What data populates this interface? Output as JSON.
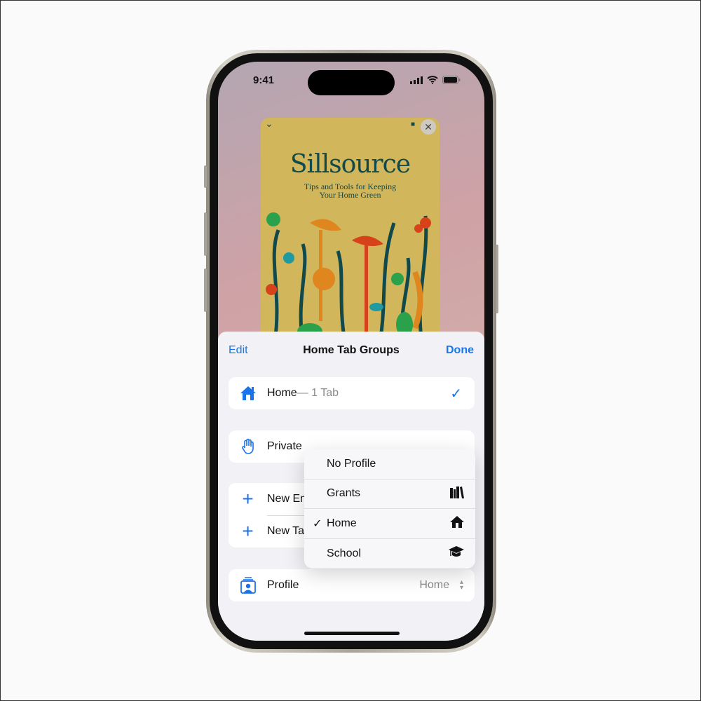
{
  "status": {
    "time": "9:41"
  },
  "card": {
    "title": "Sillsource",
    "subtitle1": "Tips and Tools for Keeping",
    "subtitle2": "Your Home Green",
    "close": "✕",
    "chevron": "⌄"
  },
  "sheet": {
    "edit": "Edit",
    "title": "Home Tab Groups",
    "done": "Done"
  },
  "rows": {
    "home": {
      "label": "Home",
      "count": " — 1 Tab",
      "check": "✓"
    },
    "private": {
      "label": "Private"
    },
    "new_empty": {
      "label": "New Em"
    },
    "new_tab": {
      "label": "New Ta"
    },
    "profile": {
      "label": "Profile",
      "value": "Home",
      "chevron": "⌃⌄"
    }
  },
  "menu": {
    "items": [
      {
        "label": "No Profile",
        "checked": false,
        "icon": ""
      },
      {
        "label": "Grants",
        "checked": false,
        "icon": "books-icon"
      },
      {
        "label": "Home",
        "checked": true,
        "icon": "house-icon"
      },
      {
        "label": "School",
        "checked": false,
        "icon": "graduation-cap-icon"
      }
    ],
    "check": "✓"
  },
  "colors": {
    "accent": "#1976e6",
    "card": "#d2b65c",
    "cardText": "#124a4c"
  }
}
